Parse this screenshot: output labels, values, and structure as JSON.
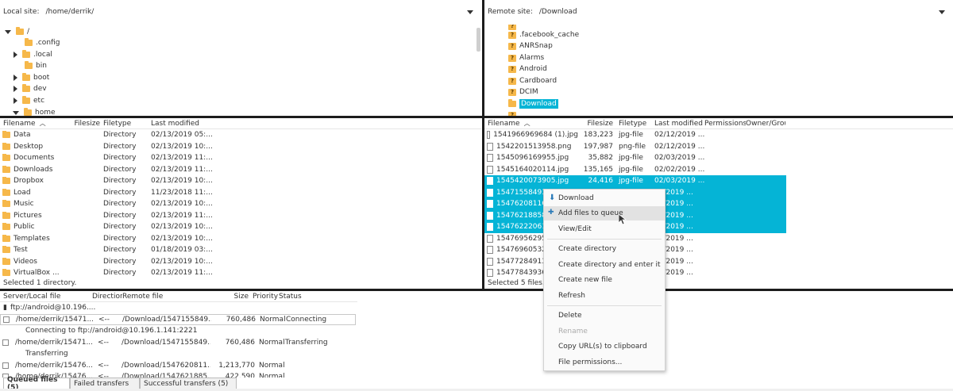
{
  "local": {
    "site_label": "Local site:",
    "site_path": "/home/derrik/",
    "tree": [
      {
        "label": "/",
        "expand": "down",
        "level": 0
      },
      {
        "label": ".config",
        "expand": "none",
        "level": 1
      },
      {
        "label": ".local",
        "expand": "right",
        "level": 1
      },
      {
        "label": "bin",
        "expand": "none",
        "level": 1
      },
      {
        "label": "boot",
        "expand": "right",
        "level": 1
      },
      {
        "label": "dev",
        "expand": "right",
        "level": 1
      },
      {
        "label": "etc",
        "expand": "right",
        "level": 1
      },
      {
        "label": "home",
        "expand": "down",
        "level": 1
      }
    ],
    "columns": {
      "filename": "Filename",
      "filesize": "Filesize",
      "filetype": "Filetype",
      "modified": "Last modified"
    },
    "files": [
      {
        "name": "Data",
        "size": "",
        "type": "Directory",
        "modified": "02/13/2019 05:..."
      },
      {
        "name": "Desktop",
        "size": "",
        "type": "Directory",
        "modified": "02/13/2019 10:..."
      },
      {
        "name": "Documents",
        "size": "",
        "type": "Directory",
        "modified": "02/13/2019 11:..."
      },
      {
        "name": "Downloads",
        "size": "",
        "type": "Directory",
        "modified": "02/13/2019 11:..."
      },
      {
        "name": "Dropbox",
        "size": "",
        "type": "Directory",
        "modified": "02/13/2019 10:..."
      },
      {
        "name": "Load",
        "size": "",
        "type": "Directory",
        "modified": "11/23/2018 11:..."
      },
      {
        "name": "Music",
        "size": "",
        "type": "Directory",
        "modified": "02/13/2019 10:..."
      },
      {
        "name": "Pictures",
        "size": "",
        "type": "Directory",
        "modified": "02/13/2019 11:..."
      },
      {
        "name": "Public",
        "size": "",
        "type": "Directory",
        "modified": "02/13/2019 10:..."
      },
      {
        "name": "Templates",
        "size": "",
        "type": "Directory",
        "modified": "02/13/2019 10:..."
      },
      {
        "name": "Test",
        "size": "",
        "type": "Directory",
        "modified": "01/18/2019 03:..."
      },
      {
        "name": "Videos",
        "size": "",
        "type": "Directory",
        "modified": "02/13/2019 10:..."
      },
      {
        "name": "VirtualBox ...",
        "size": "",
        "type": "Directory",
        "modified": "02/13/2019 11:..."
      }
    ],
    "status": "Selected 1 directory."
  },
  "remote": {
    "site_label": "Remote site:",
    "site_path": "/Download",
    "tree": [
      {
        "label": ".facebook_cache",
        "selected": false
      },
      {
        "label": "ANRSnap",
        "selected": false
      },
      {
        "label": "Alarms",
        "selected": false
      },
      {
        "label": "Android",
        "selected": false
      },
      {
        "label": "Cardboard",
        "selected": false
      },
      {
        "label": "DCIM",
        "selected": false
      },
      {
        "label": "Download",
        "selected": true
      }
    ],
    "columns": {
      "filename": "Filename",
      "filesize": "Filesize",
      "filetype": "Filetype",
      "modified": "Last modified",
      "permissions": "Permissions",
      "owner": "Owner/Grou"
    },
    "files": [
      {
        "name": "1541966969684 (1).jpg",
        "size": "183,223",
        "type": "jpg-file",
        "modified": "02/12/2019 ...",
        "selected": false
      },
      {
        "name": "1542201513958.png",
        "size": "197,987",
        "type": "png-file",
        "modified": "02/12/2019 ...",
        "selected": false
      },
      {
        "name": "1545096169955.jpg",
        "size": "35,882",
        "type": "jpg-file",
        "modified": "02/03/2019 ...",
        "selected": false
      },
      {
        "name": "1545164020114.jpg",
        "size": "135,165",
        "type": "jpg-file",
        "modified": "02/02/2019 ...",
        "selected": false
      },
      {
        "name": "1545420073905.jpg",
        "size": "24,416",
        "type": "jpg-file",
        "modified": "02/03/2019 ...",
        "selected": true
      },
      {
        "name": "154715584931",
        "size": "",
        "type": "",
        "modified": "05/2019 ...",
        "selected": true
      },
      {
        "name": "15476208116C",
        "size": "",
        "type": "",
        "modified": "27/2019 ...",
        "selected": true
      },
      {
        "name": "154762188582",
        "size": "",
        "type": "",
        "modified": "27/2019 ...",
        "selected": true
      },
      {
        "name": "154762220618",
        "size": "",
        "type": "",
        "modified": "27/2019 ...",
        "selected": true
      },
      {
        "name": "154769562959",
        "size": "",
        "type": "",
        "modified": "03/2019 ...",
        "selected": false
      },
      {
        "name": "154769605329",
        "size": "",
        "type": "",
        "modified": "03/2019 ...",
        "selected": false
      },
      {
        "name": "154772849134",
        "size": "",
        "type": "",
        "modified": "02/2019 ...",
        "selected": false
      },
      {
        "name": "154778439367",
        "size": "",
        "type": "",
        "modified": "27/2019 ...",
        "selected": false
      }
    ],
    "status": "Selected 5 files. T"
  },
  "context_menu": {
    "items": [
      {
        "label": "Download",
        "icon": "download-arrow-icon",
        "highlight": false,
        "disabled": false
      },
      {
        "label": "Add files to queue",
        "icon": "add-queue-icon",
        "highlight": true,
        "disabled": false
      },
      {
        "label": "View/Edit",
        "highlight": false,
        "disabled": false
      },
      {
        "label": "Create directory",
        "highlight": false,
        "disabled": false
      },
      {
        "label": "Create directory and enter it",
        "highlight": false,
        "disabled": false
      },
      {
        "label": "Create new file",
        "highlight": false,
        "disabled": false
      },
      {
        "label": "Refresh",
        "highlight": false,
        "disabled": false
      },
      {
        "label": "Delete",
        "highlight": false,
        "disabled": false
      },
      {
        "label": "Rename",
        "highlight": false,
        "disabled": true
      },
      {
        "label": "Copy URL(s) to clipboard",
        "highlight": false,
        "disabled": false
      },
      {
        "label": "File permissions...",
        "highlight": false,
        "disabled": false
      }
    ]
  },
  "queue": {
    "columns": {
      "server": "Server/Local file",
      "direction": "Directior",
      "remote": "Remote file",
      "size": "Size",
      "priority": "Priority",
      "status": "Status"
    },
    "server": "ftp://android@10.196....",
    "rows": [
      {
        "local": "/home/derrik/15471...",
        "dir": "<--",
        "remote": "/Download/1547155849...",
        "size": "760,486",
        "priority": "Normal",
        "status": "Connecting",
        "sub": "Connecting to ftp://android@10.196.1.141:2221"
      },
      {
        "local": "/home/derrik/15471...",
        "dir": "<--",
        "remote": "/Download/1547155849...",
        "size": "760,486",
        "priority": "Normal",
        "status": "Transferring",
        "sub": "Transferring"
      },
      {
        "local": "/home/derrik/15476...",
        "dir": "<--",
        "remote": "/Download/1547620811...",
        "size": "1,213,770",
        "priority": "Normal",
        "status": "",
        "sub": ""
      },
      {
        "local": "/home/derrik/15476...",
        "dir": "<--",
        "remote": "/Download/1547621885...",
        "size": "422,590",
        "priority": "Normal",
        "status": "",
        "sub": ""
      }
    ],
    "tabs": [
      "Queued files (5)",
      "Failed transfers",
      "Successful transfers (5)"
    ]
  }
}
